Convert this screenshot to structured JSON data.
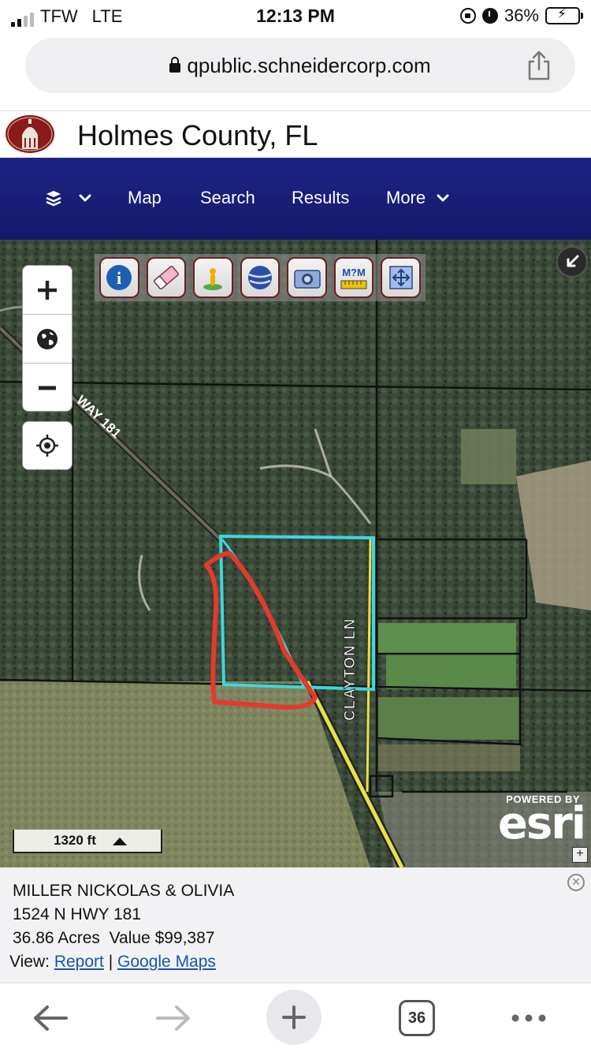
{
  "status_bar": {
    "carrier": "TFW",
    "network": "LTE",
    "time": "12:13 PM",
    "battery": "36%",
    "battery_fraction": 0.36
  },
  "browser": {
    "url": "qpublic.schneidercorp.com",
    "share_icon": "share-icon",
    "tab_count": "36"
  },
  "site": {
    "title": "Holmes County, FL",
    "logo_icon": "courthouse-logo"
  },
  "nav": {
    "layers_icon": "layers-icon",
    "items": [
      {
        "label": "Map"
      },
      {
        "label": "Search"
      },
      {
        "label": "Results"
      },
      {
        "label": "More"
      }
    ]
  },
  "map": {
    "tools": [
      "info-icon",
      "eraser-icon",
      "pin-icon",
      "globe-icon",
      "camera-icon",
      "measure-icon",
      "fullscreen-icon"
    ],
    "road_label": "WAY 181",
    "street_label": "CLAYTON LN",
    "scale": "1320 ft",
    "attribution_powered": "POWERED BY",
    "attribution_brand": "esri",
    "colors": {
      "parcel_outline": "#3fd6dc",
      "hand_drawn": "#e33a2c",
      "highway": "#e8e04a"
    }
  },
  "parcel": {
    "owner": "MILLER NICKOLAS & OLIVIA",
    "address": "1524 N HWY 181",
    "acres": "36.86 Acres",
    "value": "Value $99,387",
    "view_label": "View:",
    "report_link": "Report",
    "separator": "|",
    "google_link": "Google Maps"
  }
}
